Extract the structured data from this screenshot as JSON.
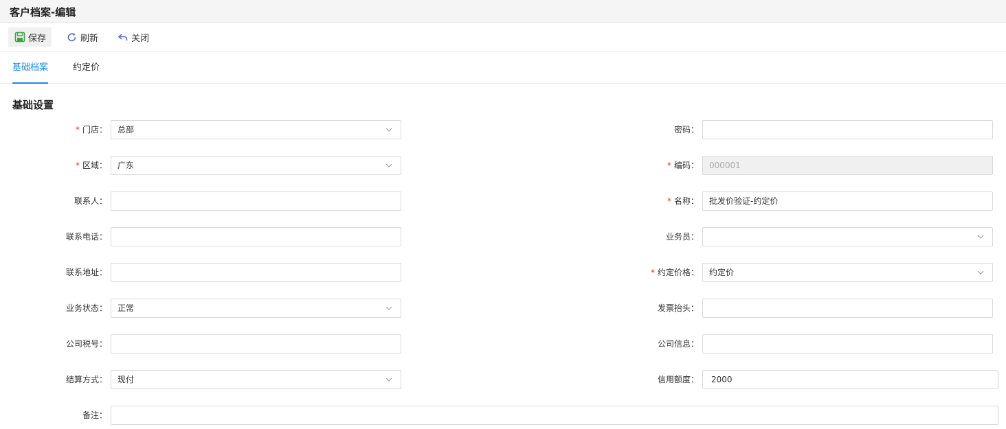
{
  "window": {
    "title": "客户档案-编辑"
  },
  "toolbar": {
    "save_label": "保存",
    "refresh_label": "刷新",
    "close_label": "关闭"
  },
  "tabs": [
    {
      "label": "基础档案",
      "active": true
    },
    {
      "label": "约定价",
      "active": false
    }
  ],
  "section": {
    "title": "基础设置"
  },
  "colors": {
    "accent": "#1e88e5",
    "required": "#e53935",
    "save_icon": "#43a047",
    "refresh_icon": "#5c6bc0"
  },
  "form": {
    "store": {
      "label": "门店：",
      "value": "总部"
    },
    "region": {
      "label": "区域：",
      "value": "广东"
    },
    "contact": {
      "label": "联系人：",
      "value": ""
    },
    "phone": {
      "label": "联系电话：",
      "value": ""
    },
    "address": {
      "label": "联系地址：",
      "value": ""
    },
    "biz_status": {
      "label": "业务状态：",
      "value": "正常"
    },
    "tax_no": {
      "label": "公司税号：",
      "value": ""
    },
    "settlement": {
      "label": "结算方式：",
      "value": "现付"
    },
    "remark": {
      "label": "备注：",
      "value": ""
    },
    "password": {
      "label": "密码：",
      "value": ""
    },
    "code": {
      "label": "编码：",
      "value": "000001"
    },
    "name": {
      "label": "名称：",
      "value": "批发价验证-约定价"
    },
    "salesman": {
      "label": "业务员：",
      "value": ""
    },
    "agreed_price": {
      "label": "约定价格：",
      "value": "约定价"
    },
    "invoice_title": {
      "label": "发票抬头：",
      "value": ""
    },
    "company_info": {
      "label": "公司信息：",
      "value": ""
    },
    "credit_limit": {
      "label": "信用额度：",
      "value": "2000"
    }
  }
}
